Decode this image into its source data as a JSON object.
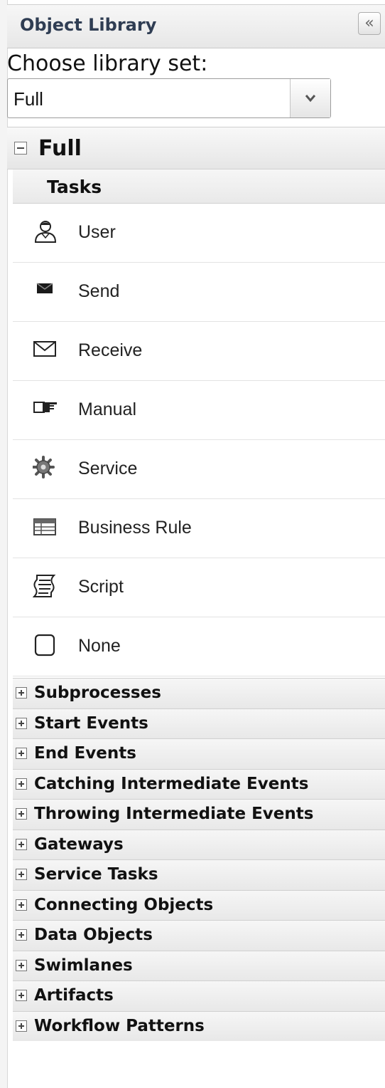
{
  "panel": {
    "title": "Object Library",
    "collapse_glyph": "«"
  },
  "chooser": {
    "label": "Choose library set:",
    "selected": "Full"
  },
  "group": {
    "title": "Full",
    "subgroup_title": "Tasks",
    "items": [
      {
        "label": "User",
        "icon": "user-icon"
      },
      {
        "label": "Send",
        "icon": "send-envelope-icon"
      },
      {
        "label": "Receive",
        "icon": "receive-envelope-icon"
      },
      {
        "label": "Manual",
        "icon": "manual-hand-icon"
      },
      {
        "label": "Service",
        "icon": "gear-icon"
      },
      {
        "label": "Business Rule",
        "icon": "table-icon"
      },
      {
        "label": "Script",
        "icon": "script-icon"
      },
      {
        "label": "None",
        "icon": "empty-task-icon"
      }
    ]
  },
  "sections": [
    "Subprocesses",
    "Start Events",
    "End Events",
    "Catching Intermediate Events",
    "Throwing Intermediate Events",
    "Gateways",
    "Service Tasks",
    "Connecting Objects",
    "Data Objects",
    "Swimlanes",
    "Artifacts",
    "Workflow Patterns"
  ]
}
